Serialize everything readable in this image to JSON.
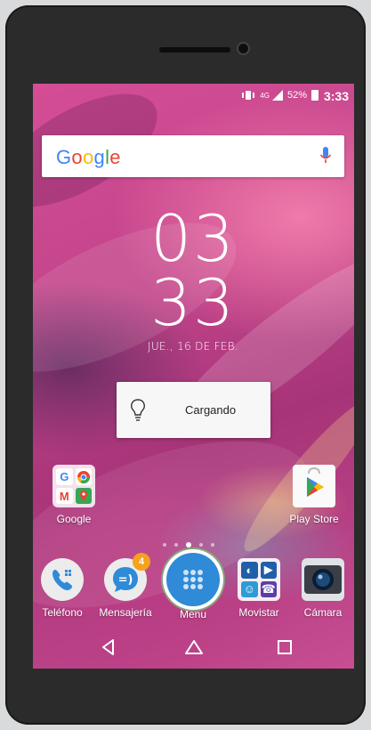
{
  "status_bar": {
    "network": "4G",
    "battery": "52%",
    "time": "3:33"
  },
  "search_bar": {
    "logo": "Google",
    "mic_icon": "microphone-icon"
  },
  "clock": {
    "hours": "03",
    "minutes": "33",
    "date": "JUE., 16 DE FEB."
  },
  "charging_widget": {
    "label": "Cargando",
    "icon": "lightbulb-icon"
  },
  "desktop_apps": [
    {
      "label": "Google",
      "icon": "google-folder-icon"
    },
    {
      "label": "Play Store",
      "icon": "play-store-icon"
    }
  ],
  "page_indicator": {
    "pages": 5,
    "current": 3
  },
  "dock": [
    {
      "label": "Teléfono",
      "icon": "phone-icon"
    },
    {
      "label": "Mensajería",
      "icon": "messaging-icon",
      "badge": "4"
    },
    {
      "label": "Menu",
      "icon": "app-drawer-icon"
    },
    {
      "label": "Movistar",
      "icon": "movistar-folder-icon"
    },
    {
      "label": "Cámara",
      "icon": "camera-icon"
    }
  ],
  "colors": {
    "wallpaper": "#c2458b",
    "google_blue": "#4285f4",
    "google_red": "#ea4335",
    "google_yellow": "#fbbc05",
    "google_green": "#34a853",
    "badge": "#f6a21c",
    "drawer": "#2f8ad8"
  }
}
